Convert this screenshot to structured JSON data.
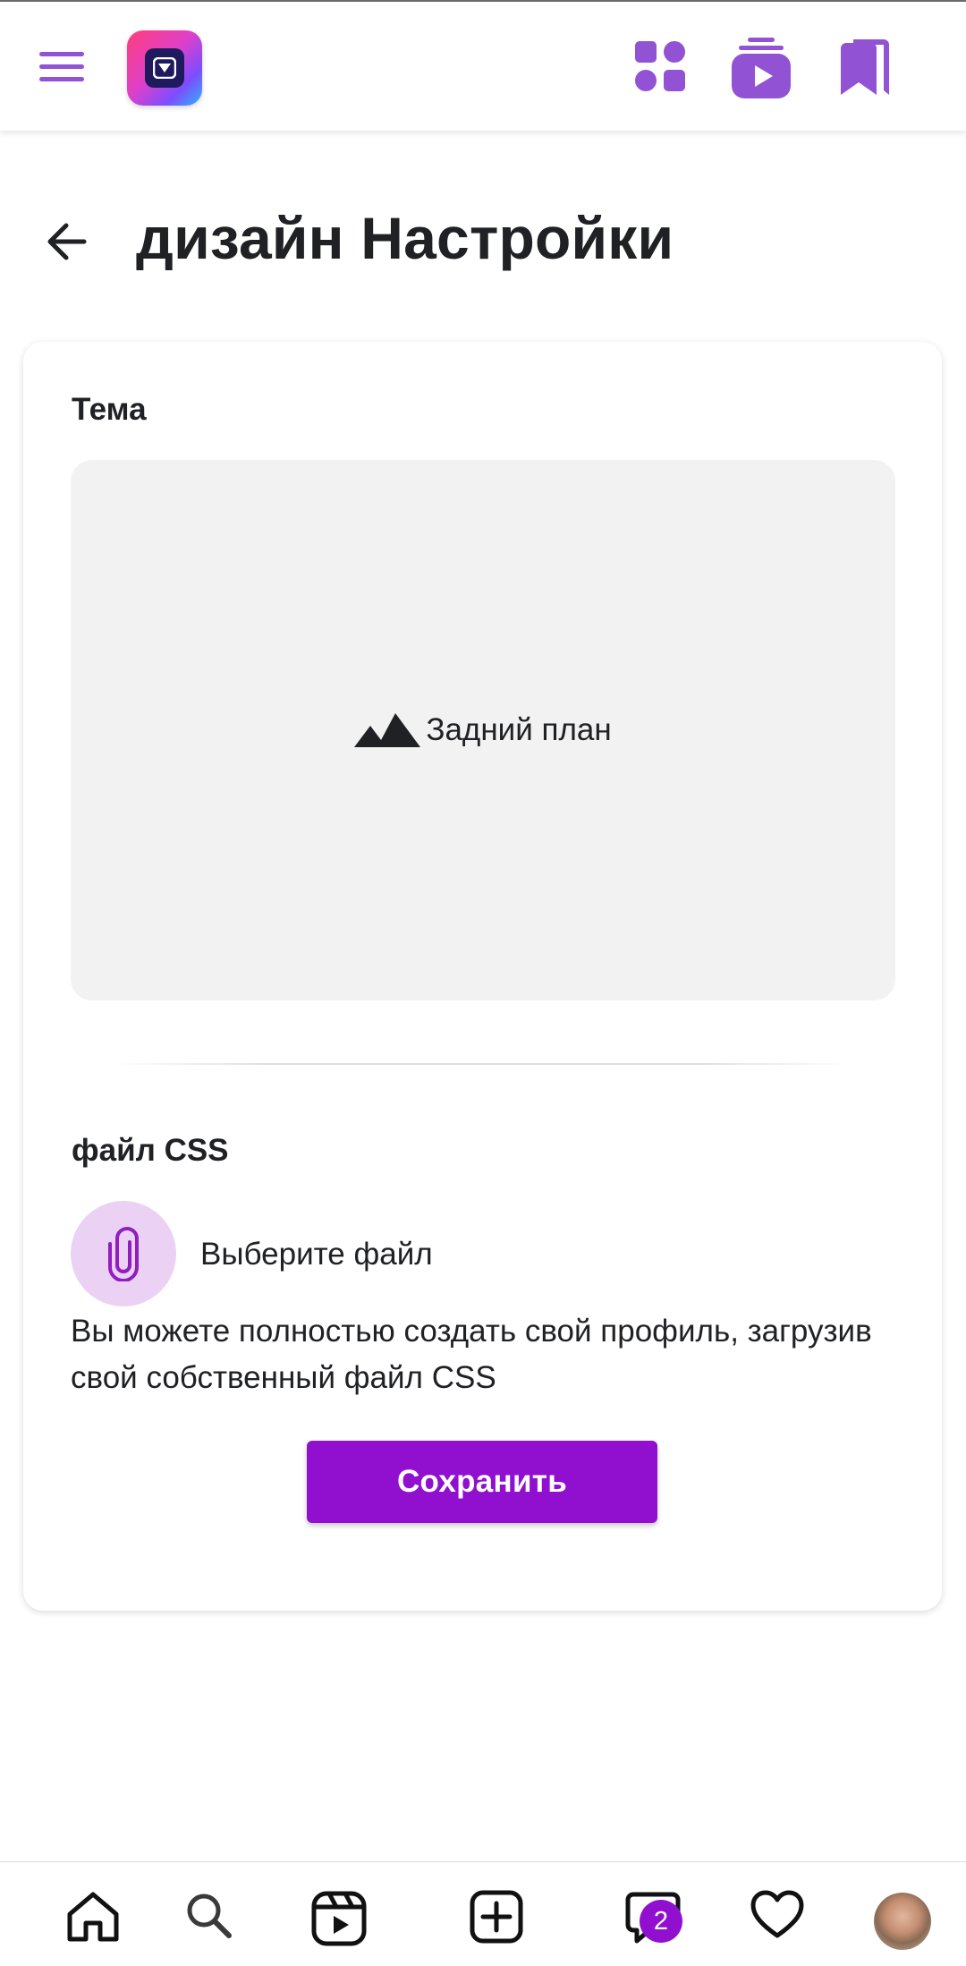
{
  "header": {
    "title": "дизайн Настройки"
  },
  "card": {
    "theme_label": "Тема",
    "background_label": "Задний план",
    "css_label": "файл CSS",
    "choose_file_label": "Выберите файл",
    "description": "Вы можете полностью создать свой профиль, загрузив свой собственный файл CSS",
    "save_label": "Сохранить"
  },
  "bottom_nav": {
    "messages_badge": "2",
    "items": [
      "home-icon",
      "search-icon",
      "reels-icon",
      "create-icon",
      "messages-icon",
      "heart-icon",
      "avatar"
    ]
  },
  "top_nav": {
    "icons": [
      "menu-icon",
      "app-logo",
      "apps-grid-icon",
      "video-library-icon",
      "bookmarks-icon"
    ]
  },
  "colors": {
    "accent": "#9110cf",
    "top_icons": "#9152d4",
    "attach_bg": "#ebd2f5",
    "background_area": "#f2f2f2"
  }
}
